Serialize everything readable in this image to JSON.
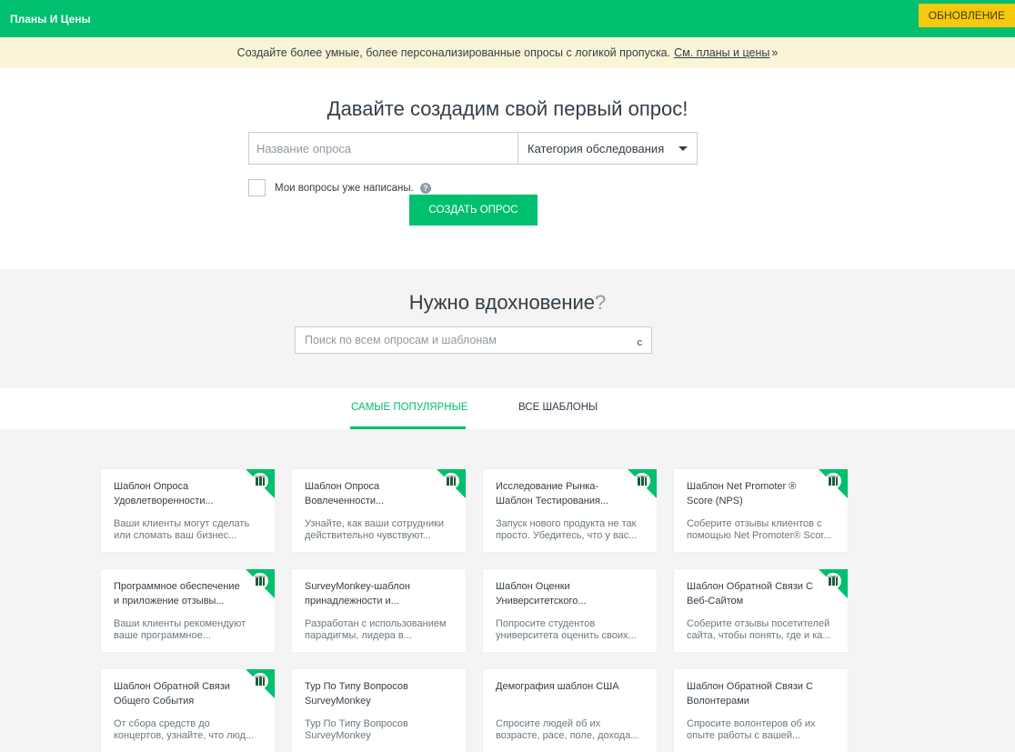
{
  "topbar": {
    "plans_label": "Планы И Цены",
    "upgrade_label": "ОБНОВЛЕНИЕ"
  },
  "promo": {
    "text": "Создайте более умные, более персонализированные опросы с логикой пропуска.",
    "link": "См. планы и цены",
    "arrow": "»"
  },
  "create": {
    "heading": "Давайте создадим свой первый опрос!",
    "title_placeholder": "Название опроса",
    "category_label": "Категория обследования",
    "checkbox_label": "Мои вопросы уже написаны.",
    "help": "?",
    "button_label": "СОЗДАТЬ ОПРОС"
  },
  "inspire": {
    "heading": "Нужно вдохновение",
    "question_mark": "?",
    "search_placeholder": "Поиск по всем опросам и шаблонам",
    "search_icon": "с"
  },
  "tabs": [
    {
      "label": "САМЫЕ ПОПУЛЯРНЫЕ",
      "active": true
    },
    {
      "label": "ВСЕ ШАБЛОНЫ",
      "active": false
    }
  ],
  "colors": {
    "brand": "#00bf6f",
    "upgrade": "#f6c90e",
    "promo_bg": "#faf5d7"
  },
  "templates": [
    {
      "title": "Шаблон Опроса Удовлетворенности...",
      "desc": "Ваши клиенты могут сделать или сломать ваш бизнес...",
      "badge": true
    },
    {
      "title": "Шаблон Опроса Вовлеченности...",
      "desc": "Узнайте, как ваши сотрудники действительно чувствуют...",
      "badge": true
    },
    {
      "title": "Исследование Рынка-Шаблон Тестирования...",
      "desc": "Запуск нового продукта не так просто. Убедитесь, что у вас...",
      "badge": true
    },
    {
      "title": "Шаблон Net Promoter ® Score (NPS)",
      "desc": "Соберите отзывы клиентов с помощью Net Promoter® Scor...",
      "badge": true
    },
    {
      "title": "Программное обеспечение и приложение отзывы...",
      "desc": "Ваши клиенты рекомендуют ваше программное...",
      "badge": true
    },
    {
      "title": "SurveyMonkey-шаблон принадлежности и...",
      "desc": "Разработан с использованием парадигмы, лидера в...",
      "badge": false
    },
    {
      "title": "Шаблон Оценки Университетского...",
      "desc": "Попросите студентов университета оценить своих...",
      "badge": false
    },
    {
      "title": "Шаблон Обратной Связи С Веб-Сайтом",
      "desc": "Соберите отзывы посетителей сайта, чтобы понять, где и ка...",
      "badge": true
    },
    {
      "title": "Шаблон Обратной Связи Общего События",
      "desc": "От сбора средств до концертов, узнайте, что люд...",
      "badge": true
    },
    {
      "title": "Тур По Типу Вопросов SurveyMonkey",
      "desc": "Тур По Типу Вопросов SurveyMonkey",
      "badge": false
    },
    {
      "title": "Демография шаблон США",
      "desc": "Спросите людей об их возрасте, расе, поле, дохода...",
      "badge": false
    },
    {
      "title": "Шаблон Обратной Связи С Волонтерами",
      "desc": "Спросите волонтеров об их опыте работы с вашей...",
      "badge": false
    }
  ]
}
